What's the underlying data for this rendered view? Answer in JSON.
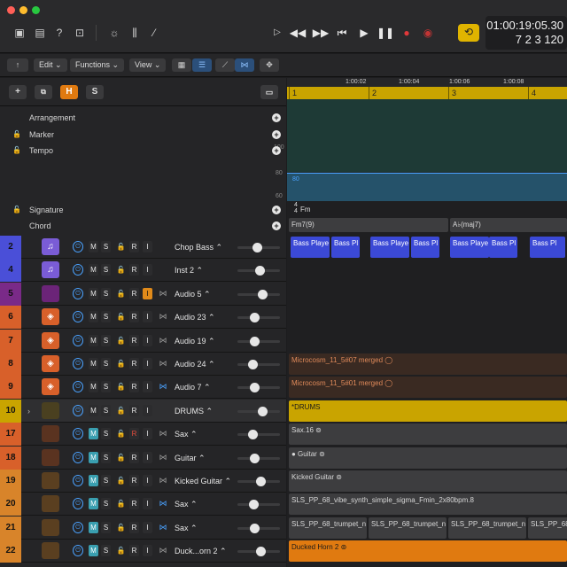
{
  "lcd": {
    "time": "01:00:19:05.30",
    "bars": "7  2  3 120"
  },
  "toolbar2": {
    "edit": "Edit",
    "functions": "Functions",
    "view": "View"
  },
  "global": {
    "h": "H",
    "s": "S"
  },
  "global_tracks": [
    {
      "label": "Arrangement",
      "lock": false
    },
    {
      "label": "Marker",
      "lock": true
    },
    {
      "label": "Tempo",
      "lock": true
    },
    {
      "label": "Signature",
      "lock": true
    },
    {
      "label": "Chord",
      "lock": false
    }
  ],
  "tempo": {
    "top": "100",
    "mid": "80",
    "low": "60",
    "line_value": "80"
  },
  "signature": {
    "value_top": "4",
    "value_bottom": "4",
    "key": "Fm"
  },
  "chords": [
    "Fm7(9)",
    "A♭(maj7)"
  ],
  "ruler": [
    "1:00:02",
    "1:00:04",
    "1:00:06",
    "1:00:08"
  ],
  "bars": [
    "1",
    "2",
    "3",
    "4"
  ],
  "colors": {
    "accent_blue": "#4aa2ff",
    "cycle_yellow": "#c9a400",
    "region_blue": "#3b49d6",
    "orange": "#e07a10"
  },
  "tracks": [
    {
      "num": "2",
      "name": "Chop Bass",
      "color": "#4a4fd8",
      "icon": "♫",
      "icon_bg": "#7a5cd6",
      "m_on": false,
      "r_armed": false,
      "i_on": false,
      "loop": "none",
      "knob": 0.42
    },
    {
      "num": "4",
      "name": "Inst 2",
      "color": "#4a4fd8",
      "icon": "♫",
      "icon_bg": "#7a5cd6",
      "m_on": false,
      "r_armed": false,
      "i_on": false,
      "loop": "none",
      "knob": 0.5
    },
    {
      "num": "5",
      "name": "Audio 5",
      "color": "#7a2a88",
      "icon": "",
      "icon_bg": "#6b2478",
      "m_on": false,
      "r_armed": false,
      "i_on": true,
      "loop": "gray",
      "knob": 0.58
    },
    {
      "num": "6",
      "name": "Audio 23",
      "color": "#d8602a",
      "icon": "◈",
      "icon_bg": "#d8602a",
      "m_on": false,
      "r_armed": false,
      "i_on": false,
      "loop": "gray",
      "knob": 0.35
    },
    {
      "num": "7",
      "name": "Audio 19",
      "color": "#d8602a",
      "icon": "◈",
      "icon_bg": "#d8602a",
      "m_on": false,
      "r_armed": false,
      "i_on": false,
      "loop": "gray",
      "knob": 0.36
    },
    {
      "num": "8",
      "name": "Audio 24",
      "color": "#d8602a",
      "icon": "◈",
      "icon_bg": "#d8602a",
      "m_on": false,
      "r_armed": false,
      "i_on": false,
      "loop": "gray",
      "knob": 0.3
    },
    {
      "num": "9",
      "name": "Audio 7",
      "color": "#d8602a",
      "icon": "◈",
      "icon_bg": "#d8602a",
      "m_on": false,
      "r_armed": false,
      "i_on": false,
      "loop": "blue",
      "knob": 0.36
    },
    {
      "num": "10",
      "name": "DRUMS",
      "color": "#c9a400",
      "icon": "",
      "icon_bg": "#4a4020",
      "m_on": false,
      "r_armed": false,
      "i_on": false,
      "loop": "none",
      "knob": 0.58
    },
    {
      "num": "17",
      "name": "Sax",
      "color": "#d8602a",
      "icon": "",
      "icon_bg": "#5a3320",
      "m_on": true,
      "r_armed": true,
      "i_on": false,
      "loop": "gray",
      "knob": 0.3
    },
    {
      "num": "18",
      "name": "Guitar",
      "color": "#d8602a",
      "icon": "",
      "icon_bg": "#5a3320",
      "m_on": true,
      "r_armed": false,
      "i_on": false,
      "loop": "gray",
      "knob": 0.36
    },
    {
      "num": "19",
      "name": "Kicked Guitar",
      "color": "#d8842a",
      "icon": "",
      "icon_bg": "#5a3f20",
      "m_on": true,
      "r_armed": false,
      "i_on": false,
      "loop": "gray",
      "knob": 0.52
    },
    {
      "num": "20",
      "name": "Sax",
      "color": "#d8842a",
      "icon": "",
      "icon_bg": "#5a3f20",
      "m_on": true,
      "r_armed": false,
      "i_on": false,
      "loop": "blue",
      "knob": 0.32
    },
    {
      "num": "21",
      "name": "Sax",
      "color": "#d8842a",
      "icon": "",
      "icon_bg": "#5a3f20",
      "m_on": true,
      "r_armed": false,
      "i_on": false,
      "loop": "blue",
      "knob": 0.36
    },
    {
      "num": "22",
      "name": "Duck...orn 2",
      "color": "#d8842a",
      "icon": "",
      "icon_bg": "#5a3f20",
      "m_on": true,
      "r_armed": false,
      "i_on": false,
      "loop": "gray",
      "knob": 0.52
    }
  ],
  "regions": {
    "chop_bass": [
      "Bass Playe",
      "Bass Pl",
      "Bass Playe",
      "Bass Pl",
      "Bass Playe",
      "Bass Pl",
      "Bass Pl"
    ],
    "audio24": "Microcosm_11_5#07 merged",
    "audio7": "Microcosm_11_5#01 merged",
    "drums": "*DRUMS",
    "sax17": "Sax.16",
    "guitar18": "Guitar",
    "kicked": "Kicked Guitar",
    "sax20": "SLS_PP_68_vibe_synth_simple_sigma_Fmin_2x80bpm.8",
    "sax21": [
      "SLS_PP_68_trumpet_n",
      "SLS_PP_68_trumpet_n",
      "SLS_PP_68_trumpet_n",
      "SLS_PP_68_trumpet_n"
    ],
    "ducked": "Ducked Horn 2"
  }
}
